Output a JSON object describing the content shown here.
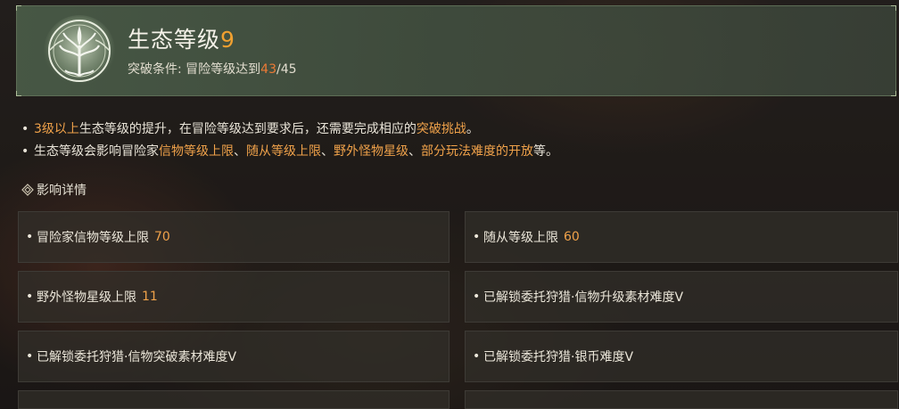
{
  "header": {
    "title": "生态等级",
    "level": "9",
    "condition_label": "突破条件: 冒险等级达到",
    "condition_current": "43",
    "condition_max": "/45"
  },
  "bullets": [
    [
      {
        "text": "3级以上",
        "hl": true
      },
      {
        "text": "生态等级的提升，在冒险等级达到要求后，还需要完成相应的",
        "hl": false
      },
      {
        "text": "突破挑战",
        "hl": true
      },
      {
        "text": "。",
        "hl": false
      }
    ],
    [
      {
        "text": "生态等级会影响冒险家",
        "hl": false
      },
      {
        "text": "信物等级上限",
        "hl": true
      },
      {
        "text": "、",
        "hl": false
      },
      {
        "text": "随从等级上限",
        "hl": true
      },
      {
        "text": "、",
        "hl": false
      },
      {
        "text": "野外怪物星级",
        "hl": true
      },
      {
        "text": "、",
        "hl": false
      },
      {
        "text": "部分玩法难度的开放",
        "hl": true
      },
      {
        "text": "等。",
        "hl": false
      }
    ]
  ],
  "section": {
    "icon": "ornament-diamond-icon",
    "label": "影响详情"
  },
  "details": [
    {
      "label": "冒险家信物等级上限",
      "value": "70"
    },
    {
      "label": "随从等级上限",
      "value": "60"
    },
    {
      "label": "野外怪物星级上限",
      "value": "11"
    },
    {
      "label": "已解锁委托狩猎·信物升级素材难度V",
      "value": ""
    },
    {
      "label": "已解锁委托狩猎·信物突破素材难度V",
      "value": ""
    },
    {
      "label": "已解锁委托狩猎·银币难度V",
      "value": ""
    }
  ],
  "colors": {
    "highlight": "#f0a24a",
    "level": "#f0a030",
    "current": "#ec7a35",
    "header_bg": "#4a5c48"
  }
}
